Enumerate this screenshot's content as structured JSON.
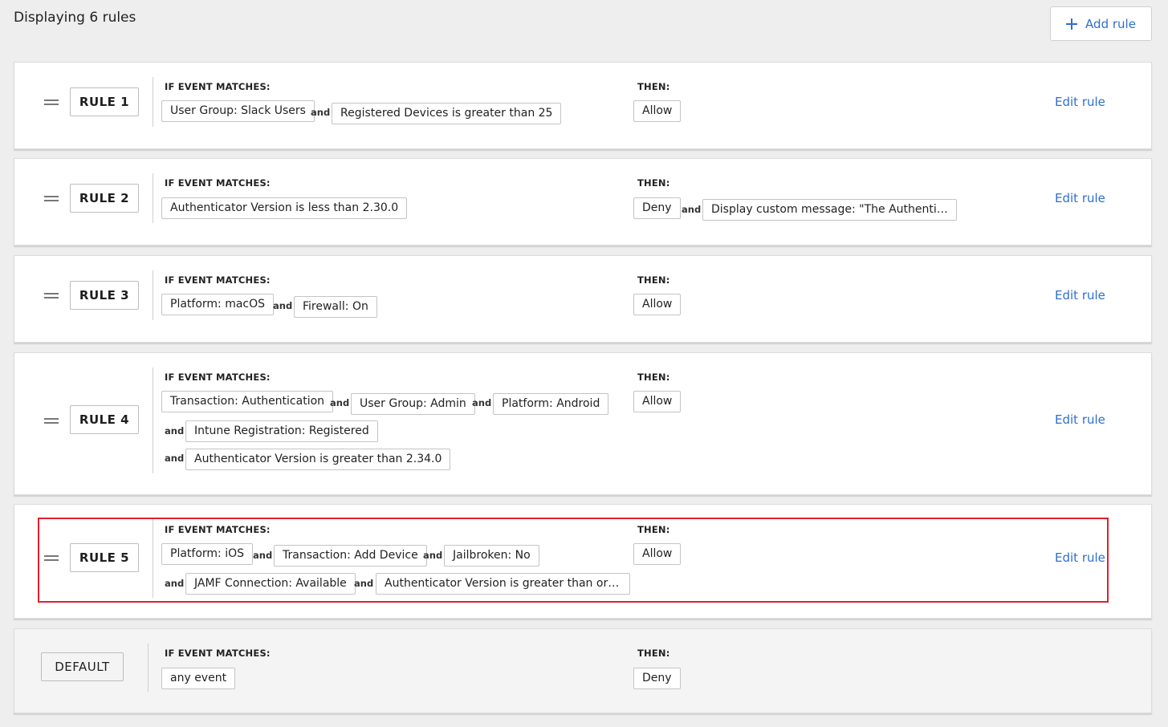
{
  "header": {
    "title": "Displaying 6 rules",
    "add_rule_label": "Add rule"
  },
  "labels": {
    "if_event_matches": "IF EVENT MATCHES:",
    "then": "THEN:",
    "and": "and",
    "edit_rule": "Edit rule"
  },
  "rules": [
    {
      "label": "RULE 1",
      "conditions": [
        "User Group: Slack Users",
        "Registered Devices is greater than 25"
      ],
      "actions": [
        "Allow"
      ]
    },
    {
      "label": "RULE 2",
      "conditions": [
        "Authenticator Version is less than 2.30.0"
      ],
      "actions": [
        "Deny",
        "Display custom message: \"The Authentica..."
      ]
    },
    {
      "label": "RULE 3",
      "conditions": [
        "Platform: macOS",
        "Firewall: On"
      ],
      "actions": [
        "Allow"
      ]
    },
    {
      "label": "RULE 4",
      "conditions": [
        "Transaction: Authentication",
        "User Group: Admin",
        "Platform: Android",
        "Intune Registration: Registered",
        "Authenticator Version is greater than 2.34.0"
      ],
      "actions": [
        "Allow"
      ]
    },
    {
      "label": "RULE 5",
      "conditions": [
        "Platform: iOS",
        "Transaction: Add Device",
        "Jailbroken: No",
        "JAMF Connection: Available",
        "Authenticator Version is greater than or e..."
      ],
      "actions": [
        "Allow"
      ]
    },
    {
      "label": "DEFAULT",
      "conditions": [
        "any event"
      ],
      "actions": [
        "Deny"
      ]
    }
  ],
  "colors": {
    "accent": "#2e6fd0",
    "highlight": "#e0202e"
  }
}
